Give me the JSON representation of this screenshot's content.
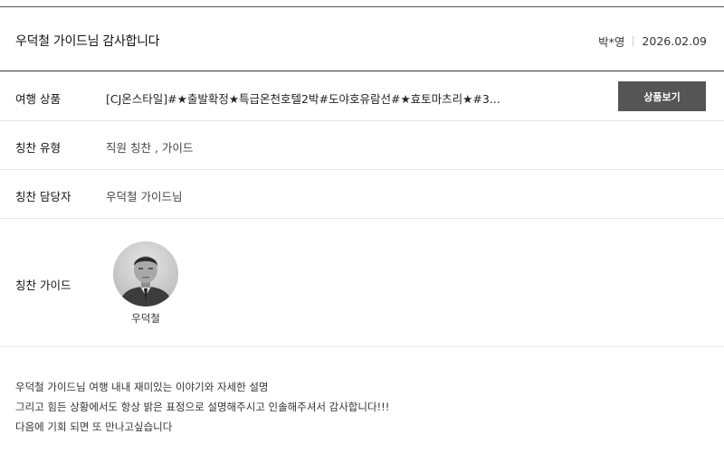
{
  "review": {
    "title": "우덕철 가이드님 감사합니다",
    "author": "박*영",
    "date": "2026.02.09"
  },
  "rows": {
    "product": {
      "label": "여행 상품",
      "value": "[CJ온스타일]#★출발확정★특급온천호텔2박#도야호유람선#★효토마츠리★#3...",
      "button_label": "상품보기"
    },
    "praise_type": {
      "label": "칭찬 유형",
      "value": "직원 칭찬 , 가이드"
    },
    "praise_target": {
      "label": "칭찬 담당자",
      "value": "우덕철 가이드님"
    },
    "praise_guide": {
      "label": "칭찬 가이드",
      "guide_name": "우덕철",
      "avatar_icon": "guide-photo"
    }
  },
  "body": {
    "lines": [
      "우덕철 가이드님 여행 내내 재미있는 이야기와 자세한 설명",
      "그리고 힘든 상황에서도 항상 밝은 표정으로 설명해주시고 인솔해주셔서 감사합니다!!!",
      "다음에 기회 되면 또 만나고싶습니다"
    ]
  }
}
